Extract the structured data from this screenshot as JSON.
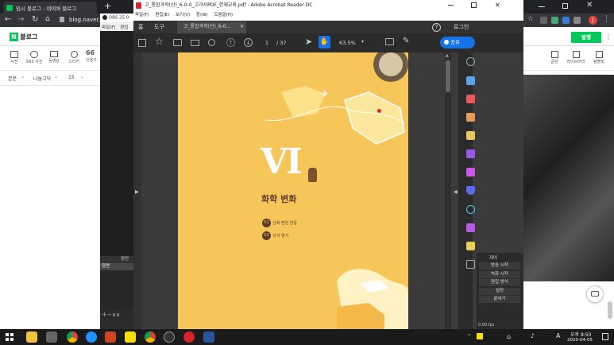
{
  "chrome": {
    "tab1_title": "임시 블로그 : 네이버 블로그",
    "url": "blog.naver.c...",
    "new_tab": "+",
    "profile_letter": "J"
  },
  "blog": {
    "logo_letter": "N",
    "logo_text": "블로그",
    "publish_label": "발행",
    "tools": [
      "사진",
      "SNS 사진",
      "동영상",
      "스티커",
      "인용구"
    ],
    "tool_quote_glyph": "66",
    "format": {
      "style": "본문",
      "font": "나눔고딕",
      "size": "15"
    },
    "right_tools": [
      "글감",
      "라이브러리",
      "템플릿"
    ]
  },
  "obs": {
    "title": "OBS 25.0",
    "menu": [
      "파일(F)",
      "편집"
    ],
    "scene_header": "장면",
    "scene_item": "장면",
    "controls_header": "제어",
    "buttons": [
      "방송 시작",
      "녹화 시작",
      "편집 방식",
      "설정",
      "끝내기"
    ],
    "fps": "0.00 fps"
  },
  "acrobat": {
    "window_title": "고_통합과학(신)_6-0-0_고과서PDF_한재교육.pdf - Adobe Acrobat Reader DC",
    "menu": [
      "파일(F)",
      "편집(E)",
      "보기(V)",
      "창(W)",
      "도움말(H)"
    ],
    "tabs": {
      "home": "홈",
      "tools": "도구",
      "doc": "고_통합과학(신)_6-0..."
    },
    "help_label": "?",
    "login_label": "로그인",
    "page_current": "1",
    "page_total": "/ 37",
    "zoom": "63.5%",
    "share_label": "공유"
  },
  "pdf": {
    "numeral": "VI",
    "chapter_title": "화학 변화",
    "items": [
      {
        "num": "01",
        "label": "산화 환원 반응"
      },
      {
        "num": "02",
        "label": "산과 염기"
      }
    ]
  },
  "taskbar": {
    "ime": "A",
    "time": "오후 9:50",
    "date": "2020-04-05"
  },
  "colors": {
    "pdf_bg": "#f7c65b",
    "accent_blue": "#1a73e8",
    "naver_green": "#03c75a",
    "acrobat_dark": "#323232"
  }
}
